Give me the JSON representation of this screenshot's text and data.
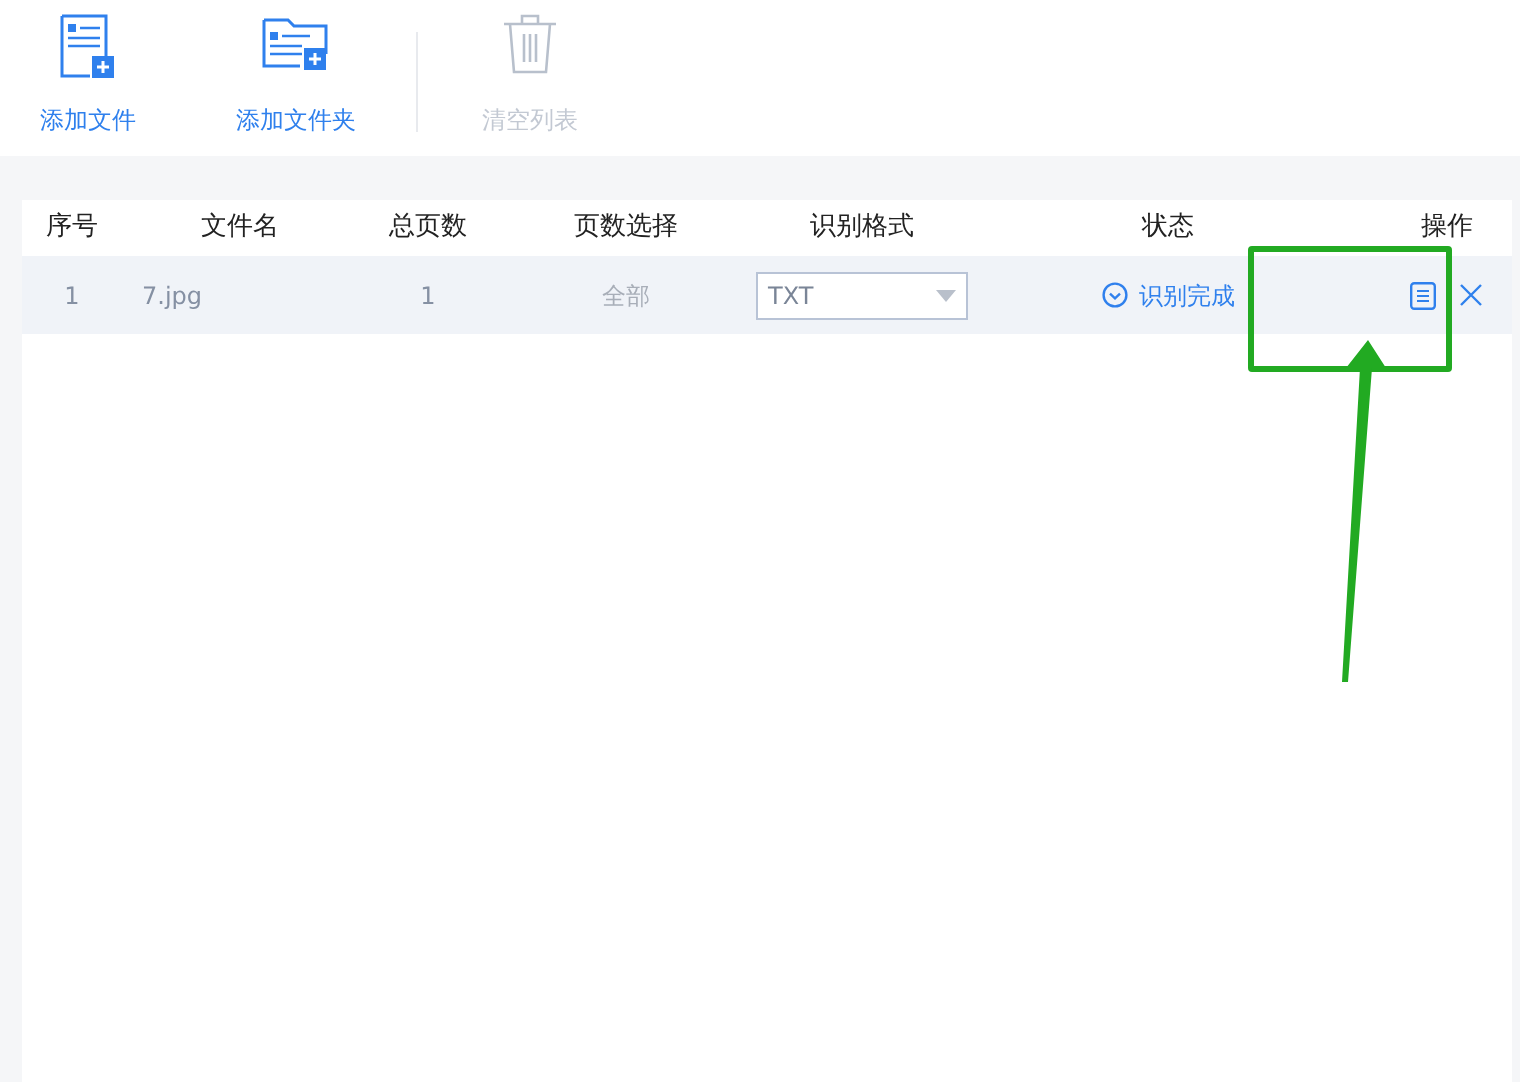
{
  "toolbar": [
    {
      "kind": "file",
      "label": "添加文件",
      "disabled": false
    },
    {
      "kind": "folder",
      "label": "添加文件夹",
      "disabled": false
    },
    {
      "kind": "trash",
      "label": "清空列表",
      "disabled": true
    }
  ],
  "table": {
    "columns": [
      "序号",
      "文件名",
      "总页数",
      "页数选择",
      "识别格式",
      "状态",
      "操作"
    ],
    "rows": [
      {
        "index": "1",
        "filename": "7.jpg",
        "total_pages": "1",
        "page_selection": "全部",
        "format": "TXT",
        "status": "识别完成"
      }
    ]
  }
}
